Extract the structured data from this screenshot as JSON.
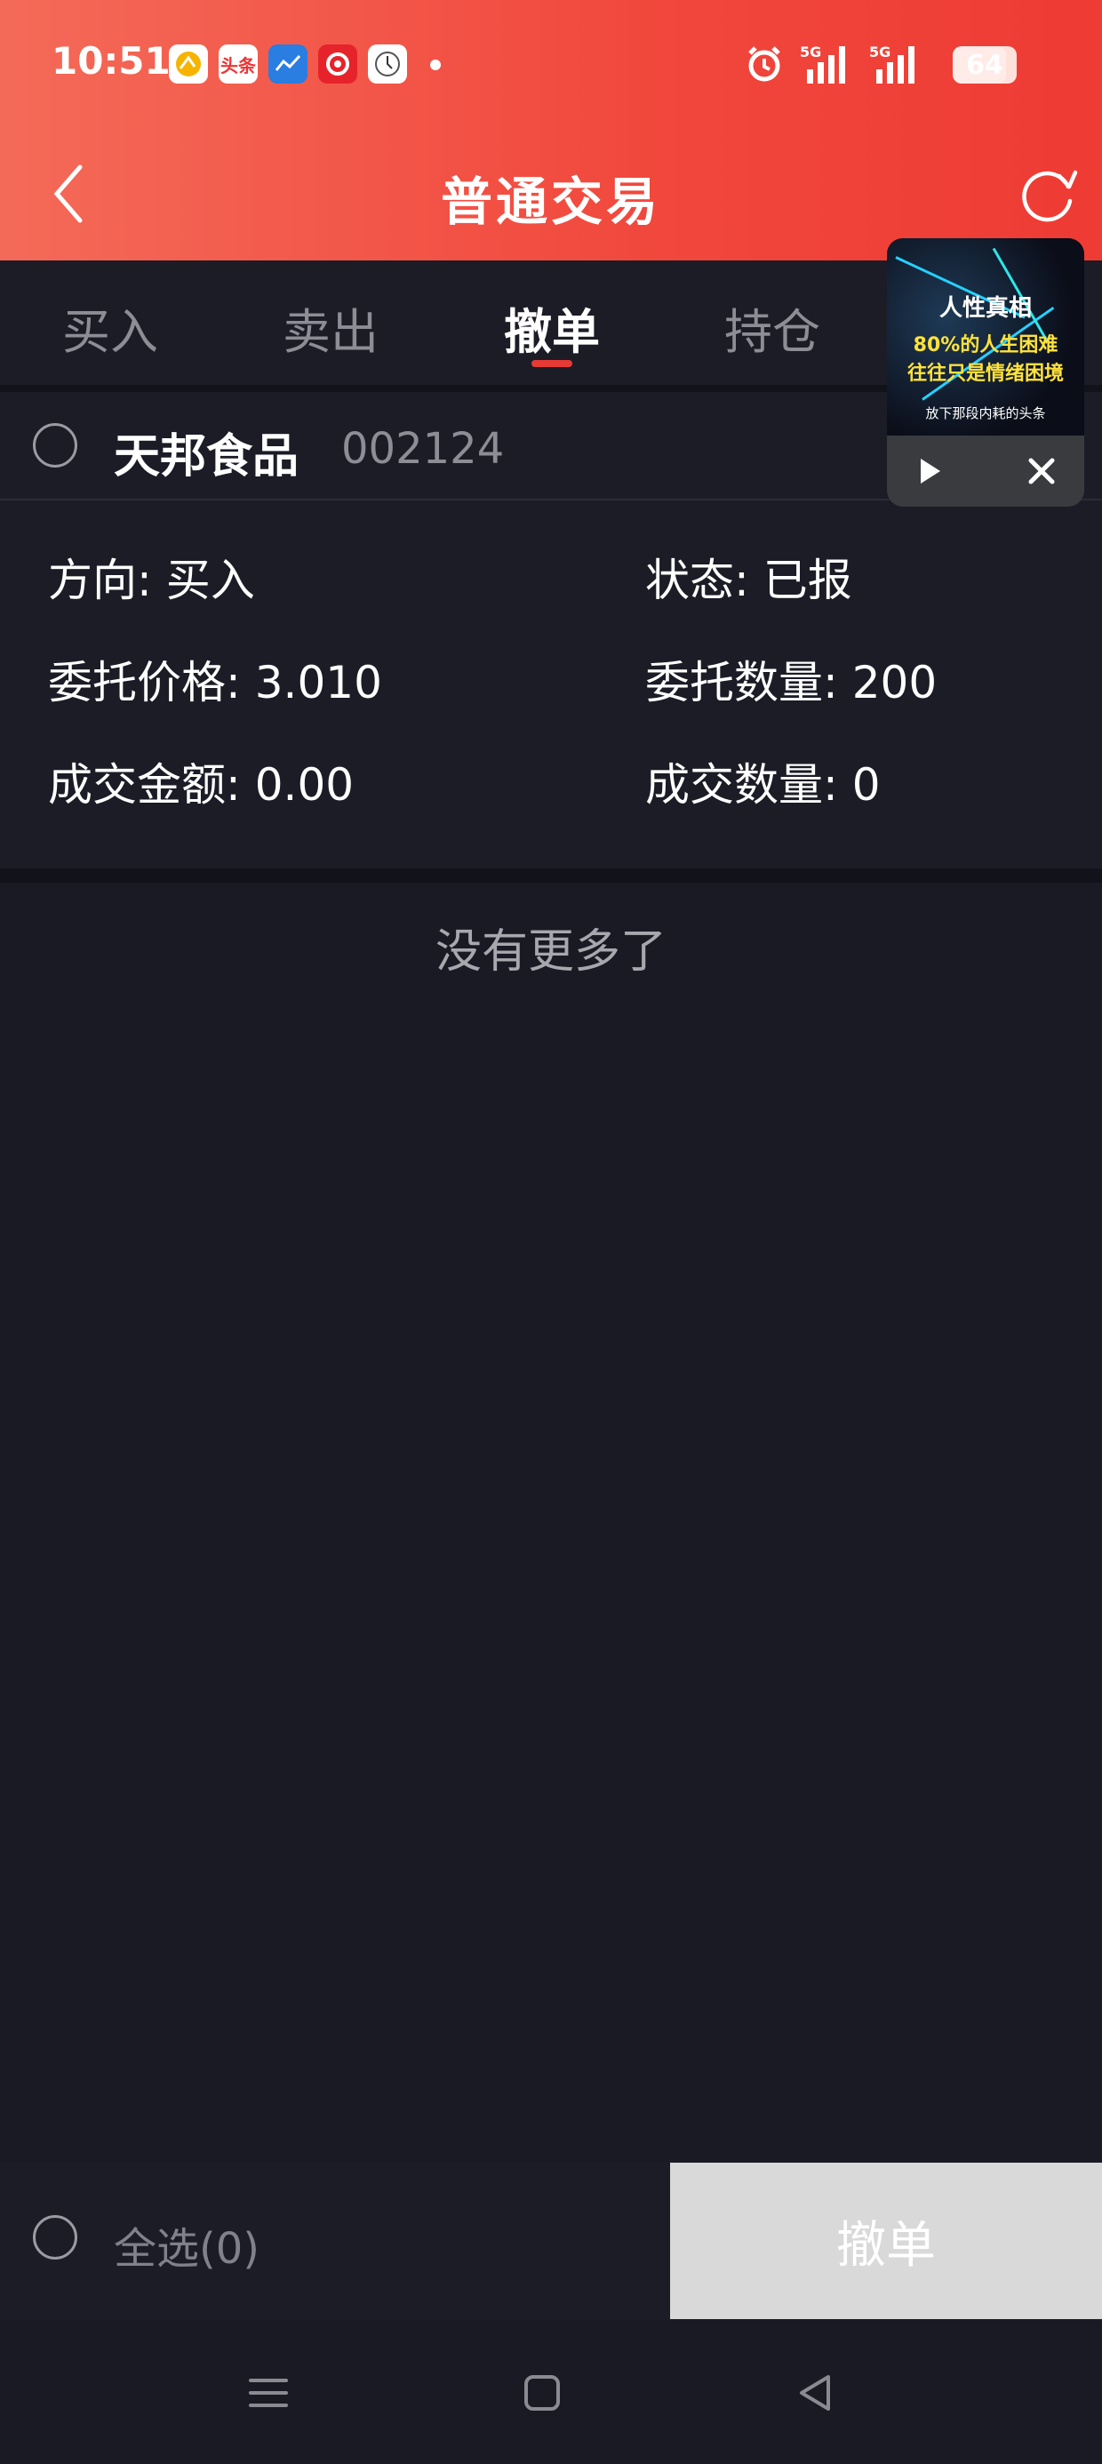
{
  "status_bar": {
    "time": "10:51",
    "notification_icons": [
      "app-icon",
      "头条",
      "chart-app-icon",
      "finance-app-icon",
      "clock-app-icon"
    ],
    "network1": "5G",
    "network2": "5G",
    "battery": "64"
  },
  "header": {
    "title": "普通交易"
  },
  "tabs": [
    {
      "label": "买入"
    },
    {
      "label": "卖出"
    },
    {
      "label": "撤单"
    },
    {
      "label": "持仓"
    }
  ],
  "active_tab": "撤单",
  "order": {
    "stock_name": "天邦食品",
    "stock_code": "002124",
    "direction_label": "方向: 买入",
    "status_label": "状态: 已报",
    "price_label": "委托价格: 3.010",
    "quantity_label": "委托数量: 200",
    "amount_label": "成交金额: 0.00",
    "filled_label": "成交数量: 0"
  },
  "no_more": "没有更多了",
  "footer": {
    "select_all": "全选(0)",
    "cancel_button": "撤单"
  },
  "pip_ad": {
    "line1": "人性真相",
    "line2": "80%的人生困难",
    "line3": "往往只是情绪困境",
    "line4": "放下那段内耗的头条"
  },
  "colors": {
    "header_red": "#f1473c",
    "tab_underline": "#e63a35",
    "background": "#191a23",
    "cancel_button_bg": "#d9d9d9"
  }
}
